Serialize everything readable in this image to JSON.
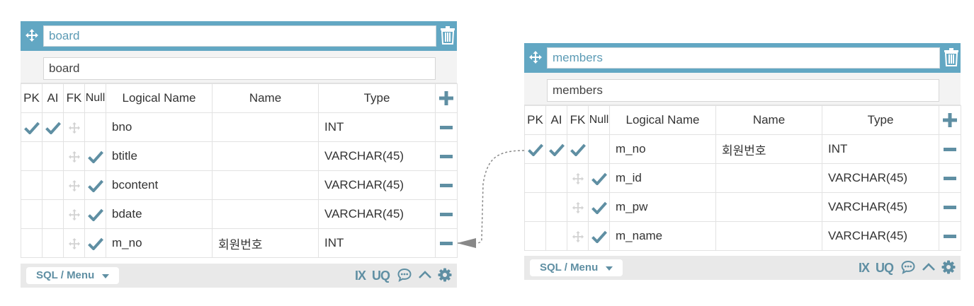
{
  "colors": {
    "header": "#62a7c3",
    "accent": "#5f8fa3",
    "footer": "#e9e9e9"
  },
  "tables": [
    {
      "header_name": "board",
      "logical_name": "board",
      "columns_header": {
        "pk": "PK",
        "ai": "AI",
        "fk": "FK",
        "null": "Null",
        "logical": "Logical Name",
        "name": "Name",
        "type": "Type"
      },
      "rows": [
        {
          "pk": true,
          "ai": true,
          "fk": "move-icon",
          "null": false,
          "logical": "bno",
          "name": "",
          "type": "INT"
        },
        {
          "pk": false,
          "ai": false,
          "fk": "move-icon",
          "null": true,
          "logical": "btitle",
          "name": "",
          "type": "VARCHAR(45)"
        },
        {
          "pk": false,
          "ai": false,
          "fk": "move-icon",
          "null": true,
          "logical": "bcontent",
          "name": "",
          "type": "VARCHAR(45)"
        },
        {
          "pk": false,
          "ai": false,
          "fk": "move-icon",
          "null": true,
          "logical": "bdate",
          "name": "",
          "type": "VARCHAR(45)"
        },
        {
          "pk": false,
          "ai": false,
          "fk": "move-icon",
          "null": true,
          "logical": "m_no",
          "name": "회원번호",
          "type": "INT"
        }
      ],
      "footer": {
        "sql_menu": "SQL / Menu",
        "ix": "IX",
        "uq": "UQ"
      }
    },
    {
      "header_name": "members",
      "logical_name": "members",
      "columns_header": {
        "pk": "PK",
        "ai": "AI",
        "fk": "FK",
        "null": "Null",
        "logical": "Logical Name",
        "name": "Name",
        "type": "Type"
      },
      "rows": [
        {
          "pk": true,
          "ai": true,
          "fk": "check",
          "null": false,
          "logical": "m_no",
          "name": "회원번호",
          "type": "INT"
        },
        {
          "pk": false,
          "ai": false,
          "fk": "move-icon",
          "null": true,
          "logical": "m_id",
          "name": "",
          "type": "VARCHAR(45)"
        },
        {
          "pk": false,
          "ai": false,
          "fk": "move-icon",
          "null": true,
          "logical": "m_pw",
          "name": "",
          "type": "VARCHAR(45)"
        },
        {
          "pk": false,
          "ai": false,
          "fk": "move-icon",
          "null": true,
          "logical": "m_name",
          "name": "",
          "type": "VARCHAR(45)"
        }
      ],
      "footer": {
        "sql_menu": "SQL / Menu",
        "ix": "IX",
        "uq": "UQ"
      }
    }
  ],
  "relation": {
    "from": "board.m_no",
    "to": "members.m_no",
    "style": "dashed",
    "arrow": "triangle"
  }
}
